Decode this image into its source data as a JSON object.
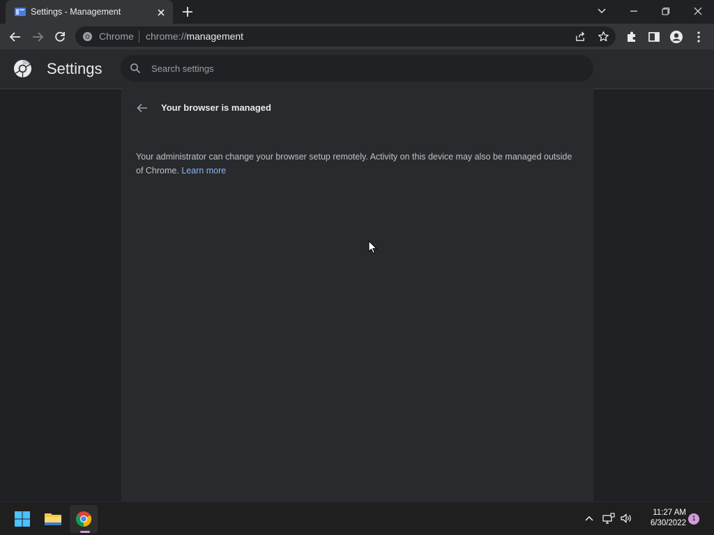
{
  "tab": {
    "title": "Settings - Management"
  },
  "omnibox": {
    "site_chip": "Chrome",
    "url_prefix": "chrome://",
    "url_host": "management"
  },
  "settings": {
    "title": "Settings",
    "search_placeholder": "Search settings"
  },
  "management": {
    "heading": "Your browser is managed",
    "description": "Your administrator can change your browser setup remotely. Activity on this device may also be managed outside of Chrome.",
    "learn_more": "Learn more"
  },
  "taskbar": {
    "time": "11:27 AM",
    "date": "6/30/2022",
    "notification_count": "1"
  },
  "colors": {
    "accent": "#8ab4f8",
    "background": "#202124",
    "surface": "#292a2d",
    "toolbar": "#35363a",
    "taskbar_indicator": "#d59ad8"
  },
  "icons": [
    "settings-favicon-icon",
    "tab-close-icon",
    "new-tab-icon",
    "tab-search-icon",
    "minimize-icon",
    "restore-icon",
    "close-icon",
    "back-icon",
    "forward-icon",
    "reload-icon",
    "chrome-site-icon",
    "share-icon",
    "bookmark-star-icon",
    "extensions-icon",
    "side-panel-icon",
    "profile-icon",
    "menu-icon",
    "chrome-logo-icon",
    "search-icon",
    "back-arrow-icon",
    "windows-start-icon",
    "file-explorer-icon",
    "chrome-taskbar-icon",
    "chevron-up-icon",
    "network-icon",
    "volume-icon"
  ]
}
